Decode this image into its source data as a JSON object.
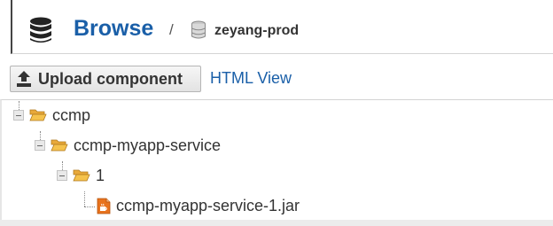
{
  "header": {
    "title": "Browse",
    "separator": "/",
    "repository": "zeyang-prod"
  },
  "toolbar": {
    "upload_label": "Upload component",
    "html_view_label": "HTML View"
  },
  "tree": {
    "root": {
      "label": "ccmp",
      "expanded": true
    },
    "level1": {
      "label": "ccmp-myapp-service",
      "expanded": true
    },
    "level2": {
      "label": "1",
      "expanded": true
    },
    "file": {
      "label": "ccmp-myapp-service-1.jar"
    }
  },
  "colors": {
    "brand_blue": "#1a5fa8",
    "accent_green": "#2fb36b",
    "folder_yellow": "#f5c24c",
    "jar_orange": "#e8731e"
  }
}
